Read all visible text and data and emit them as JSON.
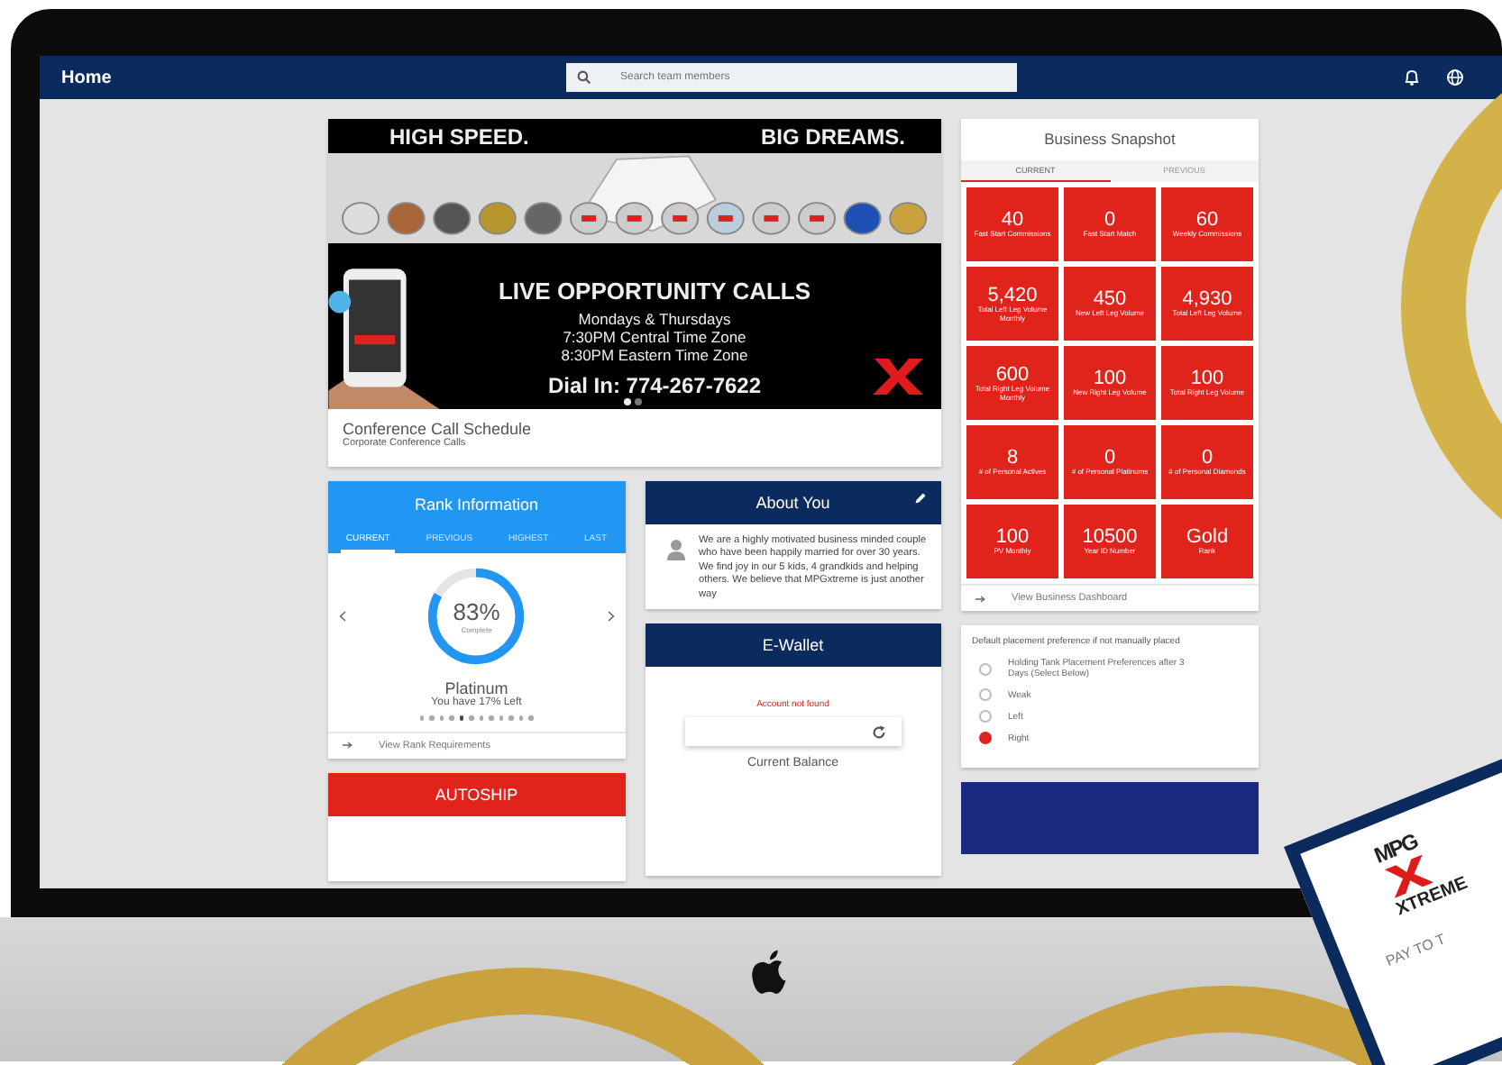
{
  "navbar": {
    "title": "Home",
    "search": {
      "placeholder": "Search team members"
    }
  },
  "banner": {
    "headline_left": "HIGH SPEED.",
    "headline_right": "BIG DREAMS.",
    "title": "LIVE OPPORTUNITY CALLS",
    "schedule": [
      "Mondays & Thursdays",
      "7:30PM Central Time Zone",
      "8:30PM Eastern Time Zone"
    ],
    "dial_in": "Dial In: 774-267-7622",
    "dots": [
      {
        "selected": true
      },
      {
        "selected": false
      }
    ],
    "caption": "Conference Call Schedule",
    "subcaption": "Corporate Conference Calls"
  },
  "rank": {
    "title": "Rank Information",
    "tabs": [
      {
        "label": "CURRENT",
        "selected": true
      },
      {
        "label": "PREVIOUS",
        "selected": false
      },
      {
        "label": "HIGHEST",
        "selected": false
      },
      {
        "label": "LAST",
        "selected": false
      }
    ],
    "level": 0.83,
    "percent": "83%",
    "percent_label": "Complete",
    "name": "Platinum",
    "remaining": "You have 17% Left",
    "dots": [
      {
        "selected": false
      },
      {
        "selected": false
      },
      {
        "selected": false
      },
      {
        "selected": false
      },
      {
        "selected": true
      },
      {
        "selected": false
      },
      {
        "selected": false
      },
      {
        "selected": false
      },
      {
        "selected": false
      },
      {
        "selected": false
      },
      {
        "selected": false
      },
      {
        "selected": false
      }
    ],
    "link": "View Rank Requirements"
  },
  "autoship": {
    "title": "AUTOSHIP"
  },
  "about": {
    "title": "About You",
    "text": "We are a highly motivated business minded couple who have been happily married for over 30 years.  We find joy in our 5 kids, 4 grandkids and helping others.  We believe that MPGxtreme is just another way"
  },
  "ewallet": {
    "title": "E-Wallet",
    "error": "Account not found",
    "balance_label": "Current Balance"
  },
  "snapshot": {
    "title": "Business Snapshot",
    "tabs": [
      {
        "label": "CURRENT",
        "selected": true
      },
      {
        "label": "PREVIOUS",
        "selected": false
      }
    ],
    "tiles": [
      {
        "value": "40",
        "label": "Fast Start Commissions"
      },
      {
        "value": "0",
        "label": "Fast Start Match"
      },
      {
        "value": "60",
        "label": "Weekly Commissions"
      },
      {
        "value": "5,420",
        "label": "Total Left Leg Volume Monthly"
      },
      {
        "value": "450",
        "label": "New Left Leg Volume"
      },
      {
        "value": "4,930",
        "label": "Total Left Leg Volume"
      },
      {
        "value": "600",
        "label": "Total Right Leg Volume Monthly"
      },
      {
        "value": "100",
        "label": "New Right Leg Volume"
      },
      {
        "value": "100",
        "label": "Total Right Leg Volume"
      },
      {
        "value": "8",
        "label": "# of Personal Actives"
      },
      {
        "value": "0",
        "label": "# of Personal Platinums"
      },
      {
        "value": "0",
        "label": "# of Personal Diamonds"
      },
      {
        "value": "100",
        "label": "PV Monthly"
      },
      {
        "value": "10500",
        "label": "Year ID Number"
      },
      {
        "value": "Gold",
        "label": "Rank"
      }
    ],
    "link": "View Business Dashboard"
  },
  "placement": {
    "question": "Default placement preference if not manually placed",
    "options": [
      {
        "label": "Holding Tank Placement Preferences after 3 Days (Select Below)",
        "selected": false
      },
      {
        "label": "Weak",
        "selected": false
      },
      {
        "label": "Left",
        "selected": false
      },
      {
        "label": "Right",
        "selected": true
      }
    ]
  },
  "promo_card": {
    "brand_top": "MPG",
    "brand": "XTREME",
    "text": "PAY TO T"
  }
}
